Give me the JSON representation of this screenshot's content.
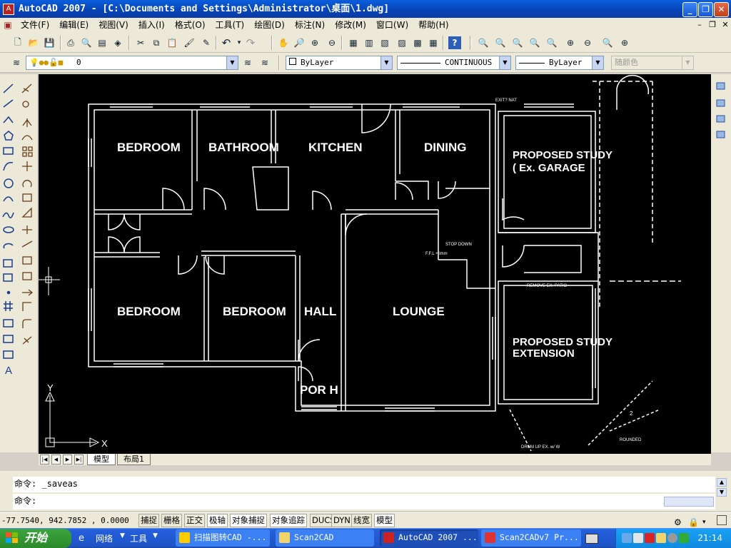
{
  "window": {
    "title": "AutoCAD 2007 - [C:\\Documents and Settings\\Administrator\\桌面\\1.dwg]",
    "app_icon": "autocad-icon"
  },
  "menu": [
    "文件(F)",
    "编辑(E)",
    "视图(V)",
    "插入(I)",
    "格式(O)",
    "工具(T)",
    "绘图(D)",
    "标注(N)",
    "修改(M)",
    "窗口(W)",
    "帮助(H)"
  ],
  "layers": {
    "current_layer": "0",
    "color": "ByLayer",
    "linetype": "CONTINUOUS",
    "lineweight": "ByLayer",
    "plot_style": "随颜色"
  },
  "drawing": {
    "rooms": [
      "BEDROOM",
      "BATHROOM",
      "KITCHEN",
      "DINING",
      "BEDROOM",
      "BEDROOM",
      "HALL",
      "LOUNGE",
      "POR H"
    ],
    "proposed": [
      "PROPOSED STUDY",
      "( Ex. GARAGE",
      "PROPOSED STUDY",
      "EXTENSION"
    ],
    "notes": [
      "EXIT? NAT",
      "F.F.L + lmm",
      "STOP DOWN",
      "REMOVE EX. PATIO",
      "DRUM UP EX. w/ W",
      "ROUNDED",
      "2"
    ],
    "ucs": {
      "x": "X",
      "y": "Y"
    }
  },
  "tabs": {
    "model": "模型",
    "layout1": "布局1"
  },
  "command": {
    "history": "命令:  _saveas",
    "prompt": "命令:"
  },
  "status": {
    "coords": "-77.7540,  942.7852 , 0.0000",
    "toggles": [
      "捕捉",
      "栅格",
      "正交",
      "极轴",
      "对象捕捉",
      "对象追踪",
      "DUCS",
      "DYN",
      "线宽",
      "模型"
    ]
  },
  "taskbar": {
    "start": "开始",
    "quicklaunch": [
      "网络",
      "工具"
    ],
    "tasks": [
      "扫描图转CAD -...",
      "Scan2CAD",
      "AutoCAD 2007 ...",
      "Scan2CADv7 Pr..."
    ],
    "clock": "21:14"
  },
  "colors": {
    "titlebar": "#0a5fdc",
    "canvas": "#000000",
    "taskbar": "#245edb",
    "start": "#3da43d"
  }
}
